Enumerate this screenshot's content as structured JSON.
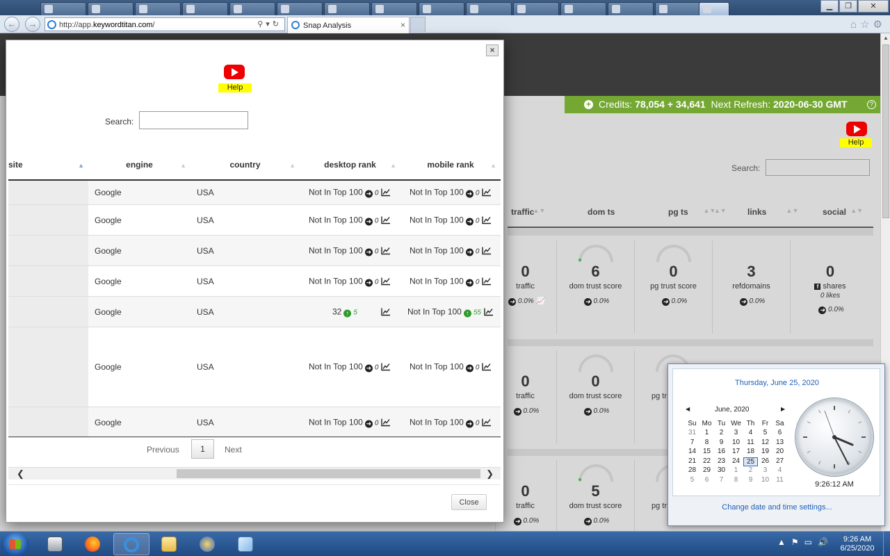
{
  "browser": {
    "address": "http://app.keywordtitan.com/",
    "address_prefix": "http://app.",
    "address_domain": "keywordtitan.com",
    "address_suffix": "/",
    "tab_title": "Snap Analysis"
  },
  "background": {
    "credits_label": "Credits:",
    "credits_value": "78,054 + 34,641",
    "refresh_label": "Next Refresh:",
    "refresh_value": "2020-06-30 GMT",
    "help_label": "Help",
    "search_label": "Search:",
    "columns": [
      "traffic",
      "dom ts",
      "pg ts",
      "links",
      "social"
    ],
    "cards_row1": [
      {
        "num": "0",
        "label": "traffic",
        "pct": "0.0%"
      },
      {
        "num": "6",
        "label": "dom trust score",
        "pct": "0.0%"
      },
      {
        "num": "0",
        "label": "pg trust score",
        "pct": "0.0%"
      },
      {
        "num": "3",
        "label": "refdomains",
        "pct": "0.0%"
      },
      {
        "num": "0",
        "label": "shares",
        "sub": "0 likes",
        "pct": "0.0%"
      }
    ],
    "cards_row2": [
      {
        "num": "0",
        "label": "traffic",
        "pct": "0.0%"
      },
      {
        "num": "0",
        "label": "dom trust score",
        "pct": "0.0%"
      },
      {
        "num": "",
        "label": "pg tr",
        "pct": ""
      }
    ],
    "cards_row3": [
      {
        "num": "0",
        "label": "traffic",
        "pct": "0.0%"
      },
      {
        "num": "5",
        "label": "dom trust score",
        "pct": "0.0%"
      },
      {
        "num": "",
        "label": "pg tr",
        "pct": ""
      }
    ]
  },
  "modal": {
    "help_label": "Help",
    "search_label": "Search:",
    "search_value": "",
    "columns": [
      "site",
      "engine",
      "country",
      "desktop rank",
      "mobile rank"
    ],
    "rows": [
      {
        "engine": "Google",
        "country": "USA",
        "desktop": "Not In Top 100",
        "desktop_change": "0",
        "desktop_dir": "right",
        "mobile": "Not In Top 100",
        "mobile_change": "0",
        "mobile_dir": "right"
      },
      {
        "engine": "Google",
        "country": "USA",
        "desktop": "Not In Top 100",
        "desktop_change": "0",
        "desktop_dir": "right",
        "mobile": "Not In Top 100",
        "mobile_change": "0",
        "mobile_dir": "right"
      },
      {
        "engine": "Google",
        "country": "USA",
        "desktop": "Not In Top 100",
        "desktop_change": "0",
        "desktop_dir": "right",
        "mobile": "Not In Top 100",
        "mobile_change": "0",
        "mobile_dir": "right"
      },
      {
        "engine": "Google",
        "country": "USA",
        "desktop": "Not In Top 100",
        "desktop_change": "0",
        "desktop_dir": "right",
        "mobile": "Not In Top 100",
        "mobile_change": "0",
        "mobile_dir": "right"
      },
      {
        "engine": "Google",
        "country": "USA",
        "desktop": "32",
        "desktop_change": "5",
        "desktop_dir": "up",
        "mobile": "Not In Top 100",
        "mobile_change": "55",
        "mobile_dir": "up"
      },
      {
        "engine": "Google",
        "country": "USA",
        "desktop": "Not In Top 100",
        "desktop_change": "0",
        "desktop_dir": "right",
        "mobile": "Not In Top 100",
        "mobile_change": "0",
        "mobile_dir": "right"
      },
      {
        "engine": "Google",
        "country": "USA",
        "desktop": "Not In Top 100",
        "desktop_change": "0",
        "desktop_dir": "right",
        "mobile": "Not In Top 100",
        "mobile_change": "0",
        "mobile_dir": "right"
      }
    ],
    "pagination": {
      "previous": "Previous",
      "current": "1",
      "next": "Next"
    },
    "close_label": "Close",
    "close_x": "×"
  },
  "calendar": {
    "full_date": "Thursday, June 25, 2020",
    "month_label": "June, 2020",
    "weekdays": [
      "Su",
      "Mo",
      "Tu",
      "We",
      "Th",
      "Fr",
      "Sa"
    ],
    "weeks": [
      [
        "31",
        "1",
        "2",
        "3",
        "4",
        "5",
        "6"
      ],
      [
        "7",
        "8",
        "9",
        "10",
        "11",
        "12",
        "13"
      ],
      [
        "14",
        "15",
        "16",
        "17",
        "18",
        "19",
        "20"
      ],
      [
        "21",
        "22",
        "23",
        "24",
        "25",
        "26",
        "27"
      ],
      [
        "28",
        "29",
        "30",
        "1",
        "2",
        "3",
        "4"
      ],
      [
        "5",
        "6",
        "7",
        "8",
        "9",
        "10",
        "11"
      ]
    ],
    "today": "25",
    "time": "9:26:12 AM",
    "settings_link": "Change date and time settings..."
  },
  "taskbar": {
    "time": "9:26 AM",
    "date": "6/25/2020"
  },
  "colors": {
    "credits_bar": "#74a832",
    "help_highlight": "#ffff00",
    "up_change": "#2f9a2f",
    "link_blue": "#1f5fb8"
  }
}
